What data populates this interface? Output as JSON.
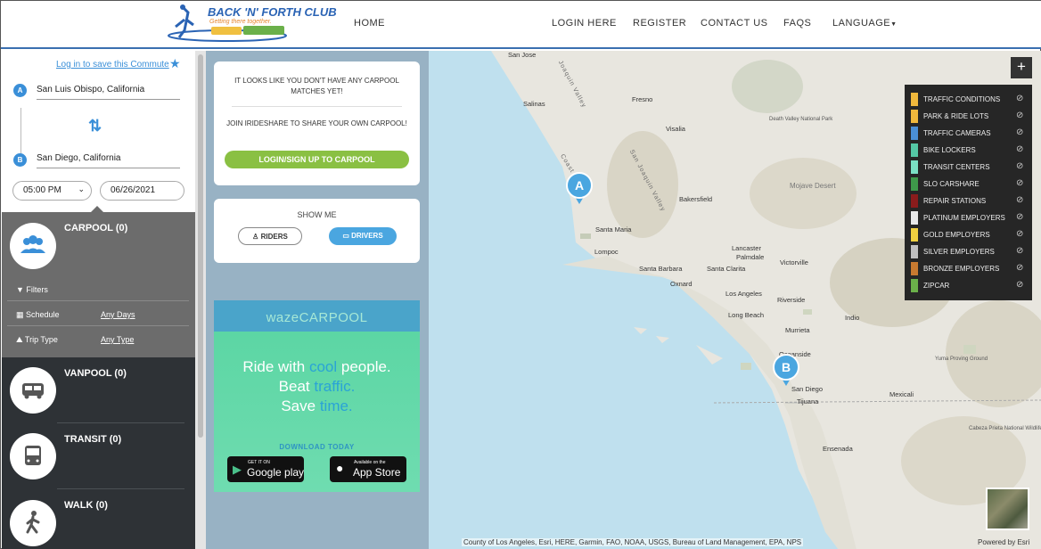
{
  "header": {
    "logo_text": "BACK 'N' FORTH CLUB",
    "logo_tagline": "Getting there together.",
    "nav": [
      {
        "label": "HOME"
      },
      {
        "label": "LOGIN HERE"
      },
      {
        "label": "REGISTER"
      },
      {
        "label": "CONTACT US"
      },
      {
        "label": "FAQS"
      },
      {
        "label": "LANGUAGE"
      }
    ]
  },
  "trip": {
    "save_link": "Log in to save this Commute",
    "origin_marker": "A",
    "origin": "San Luis Obispo, California",
    "destination_marker": "B",
    "destination": "San Diego, California",
    "time": "05:00 PM",
    "date": "06/26/2021"
  },
  "modes": [
    {
      "title": "CARPOOL (0)",
      "icon": "people-icon"
    },
    {
      "title": "VANPOOL (0)",
      "icon": "van-icon"
    },
    {
      "title": "TRANSIT (0)",
      "icon": "bus-icon"
    },
    {
      "title": "WALK (0)",
      "icon": "walk-icon"
    }
  ],
  "carpool_options": {
    "filters_label": "Filters",
    "schedule_label": "Schedule",
    "schedule_value": "Any Days",
    "trip_type_label": "Trip Type",
    "trip_type_value": "Any Type"
  },
  "matches_card": {
    "no_matches": "IT LOOKS LIKE YOU DON'T HAVE ANY CARPOOL MATCHES YET!",
    "join_text": "JOIN IRIDESHARE TO SHARE YOUR OWN CARPOOL!",
    "button": "LOGIN/SIGN UP TO CARPOOL"
  },
  "show_me": {
    "title": "SHOW ME",
    "riders": "RIDERS",
    "drivers": "DRIVERS"
  },
  "waze_ad": {
    "brand": "wazeCARPOOL",
    "line1_a": "Ride with ",
    "line1_b": "cool",
    "line1_c": " people.",
    "line2_a": "Beat ",
    "line2_b": "traffic.",
    "line3_a": "Save ",
    "line3_b": "time.",
    "download": "DOWNLOAD TODAY",
    "google_small": "GET IT ON",
    "google_big": "Google play",
    "apple_small": "Available on the",
    "apple_big": "App Store"
  },
  "map": {
    "zoom_in": "+",
    "pin_a": "A",
    "pin_b": "B",
    "cities": [
      {
        "name": "San Jose"
      },
      {
        "name": "Salinas"
      },
      {
        "name": "Fresno"
      },
      {
        "name": "Visalia"
      },
      {
        "name": "Bakersfield"
      },
      {
        "name": "Santa Maria"
      },
      {
        "name": "Lompoc"
      },
      {
        "name": "Santa Barbara"
      },
      {
        "name": "Santa Clarita"
      },
      {
        "name": "Oxnard"
      },
      {
        "name": "Los Angeles"
      },
      {
        "name": "Long Beach"
      },
      {
        "name": "Lancaster"
      },
      {
        "name": "Palmdale"
      },
      {
        "name": "Victorville"
      },
      {
        "name": "Riverside"
      },
      {
        "name": "Murrieta"
      },
      {
        "name": "Indio"
      },
      {
        "name": "Oceanside"
      },
      {
        "name": "San Diego"
      },
      {
        "name": "Tijuana"
      },
      {
        "name": "Mexicali"
      },
      {
        "name": "Ensenada"
      }
    ],
    "features": [
      {
        "name": "Death Valley National Park"
      },
      {
        "name": "Mojave Desert"
      },
      {
        "name": "Yuma Proving Ground"
      },
      {
        "name": "Cabeza Prieta National Wildlife Refuge"
      }
    ],
    "valleys": [
      {
        "name": "San Joaquin Valley"
      },
      {
        "name": "Joaquin Valley"
      },
      {
        "name": "Coast Range"
      }
    ],
    "attribution": "County of Los Angeles, Esri, HERE, Garmin, FAO, NOAA, USGS, Bureau of Land Management, EPA, NPS",
    "powered_by": "Powered by Esri"
  },
  "legend": [
    {
      "label": "TRAFFIC CONDITIONS",
      "color": "#f0b83c"
    },
    {
      "label": "PARK & RIDE LOTS",
      "color": "#f0b83c"
    },
    {
      "label": "TRAFFIC CAMERAS",
      "color": "#4a8fd6"
    },
    {
      "label": "BIKE LOCKERS",
      "color": "#55c8a6"
    },
    {
      "label": "TRANSIT CENTERS",
      "color": "#7be0c4"
    },
    {
      "label": "SLO CARSHARE",
      "color": "#3e9a4a"
    },
    {
      "label": "REPAIR STATIONS",
      "color": "#8a1c1c"
    },
    {
      "label": "PLATINUM EMPLOYERS",
      "color": "#e8e8e8"
    },
    {
      "label": "GOLD EMPLOYERS",
      "color": "#f0d040"
    },
    {
      "label": "SILVER EMPLOYERS",
      "color": "#c0c0c0"
    },
    {
      "label": "BRONZE EMPLOYERS",
      "color": "#c87a30"
    },
    {
      "label": "ZIPCAR",
      "color": "#6bb04a"
    }
  ]
}
